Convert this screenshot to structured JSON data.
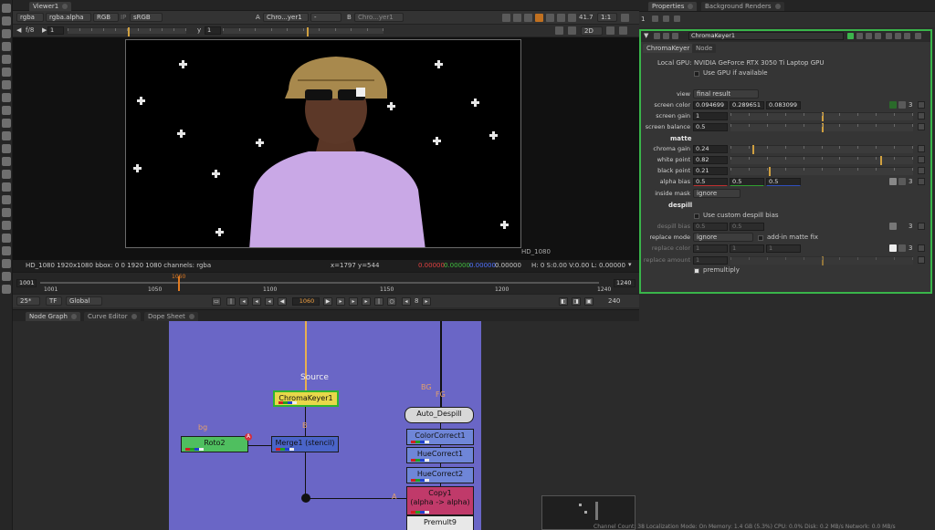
{
  "viewer": {
    "tab": "Viewer1",
    "channels": "rgba",
    "alpha_channel": "rgba.alpha",
    "colorspace_mode": "RGB",
    "ip_label": "IP",
    "display_lut": "sRGB",
    "input_a_label": "A",
    "input_a": "Chro...yer1",
    "input_b_label": "B",
    "input_b": "Chro...yer1",
    "compare_mode": "-",
    "gain": "41.7",
    "zoom": "1:1",
    "fstop": "f/8",
    "frame_val": "1",
    "y_label": "y",
    "y_val": "1",
    "view_mode": "2D",
    "format_label": "HD_1080",
    "info_left": "HD_1080 1920x1080  bbox: 0 0 1920 1080 channels: rgba",
    "info_coords": "x=1797 y=544",
    "info_r": "0.00000",
    "info_g": "0.00000",
    "info_b": "0.00000",
    "info_a": "0.00000",
    "info_hsvl": "H:  0 S:0.00 V:0.00  L: 0.00000"
  },
  "timeline": {
    "start": "1001",
    "end": "1240",
    "current": "1060",
    "ticks": [
      "1001",
      "1050",
      "1100",
      "1150",
      "1200",
      "1240"
    ],
    "playhead_marker": "1060",
    "fps": "25*",
    "tf": "TF",
    "scope": "Global",
    "current_frame_field": "1060",
    "step": "8",
    "end_field": "240"
  },
  "node_graph": {
    "tabs": [
      "Node Graph",
      "Curve Editor",
      "Dope Sheet"
    ],
    "nodes": {
      "source": "Source",
      "chromakeyer": "ChromaKeyer1",
      "roto": "Roto2",
      "merge": "Merge1 (stencil)",
      "despill": "Auto_Despill",
      "colorcorrect": "ColorCorrect1",
      "huecorrect1": "HueCorrect1",
      "huecorrect2": "HueCorrect2",
      "copy": "Copy1",
      "copy_sub": "(alpha -> alpha)",
      "premult": "Premult9"
    },
    "labels": {
      "bg": "bg",
      "b": "B",
      "a": "A",
      "bg2": "BG",
      "fg": "FG",
      "a2": "A",
      "roto_badge": "A"
    }
  },
  "properties": {
    "tabs": [
      "Properties",
      "Background Renders"
    ],
    "max_panels": "1",
    "node_name": "ChromaKeyer1",
    "subtabs": [
      "ChromaKeyer",
      "Node"
    ],
    "local_gpu_label": "Local GPU:",
    "local_gpu_value": "NVIDIA GeForce RTX 3050 Ti Laptop GPU",
    "use_gpu_label": "Use GPU if available",
    "view_label": "view",
    "view_value": "final result",
    "screen_color_label": "screen color",
    "screen_color": [
      "0.094699",
      "0.289651",
      "0.083099"
    ],
    "screen_color_count": "3",
    "screen_gain_label": "screen gain",
    "screen_gain": "1",
    "screen_balance_label": "screen balance",
    "screen_balance": "0.5",
    "matte_title": "matte",
    "chroma_gain_label": "chroma gain",
    "chroma_gain": "0.24",
    "white_point_label": "white point",
    "white_point": "0.82",
    "black_point_label": "black point",
    "black_point": "0.21",
    "alpha_bias_label": "alpha bias",
    "alpha_bias": [
      "0.5",
      "0.5",
      "0.5"
    ],
    "alpha_bias_count": "3",
    "inside_mask_label": "inside mask",
    "inside_mask": "ignore",
    "despill_title": "despill",
    "custom_despill_label": "Use custom despill bias",
    "despill_bias_label": "despill bias",
    "despill_bias": [
      "0.5",
      "0.5"
    ],
    "despill_bias_count": "3",
    "replace_mode_label": "replace mode",
    "replace_mode": "ignore",
    "addin_label": "add-in matte fix",
    "replace_color_label": "replace color",
    "replace_color": [
      "1",
      "1",
      "1"
    ],
    "replace_color_count": "3",
    "replace_amount_label": "replace amount",
    "replace_amount": "1",
    "premultiply_label": "premultiply",
    "slider_ticks_a": [
      "0",
      "0.2",
      "0.4",
      "0.6",
      "0.8",
      "1",
      "1.2",
      "1.4",
      "1.6",
      "1.8"
    ],
    "slider_ticks_b": [
      "0",
      "0.1",
      "0.2",
      "0.3",
      "0.4",
      "0.5",
      "0.6",
      "0.7",
      "0.8",
      "0.9"
    ]
  },
  "status_bar": "Channel Count: 38  Localization Mode: On  Memory: 1.4 GB (5.3%)  CPU: 0.0%  Disk: 0.2 MB/s  Network: 0.0 MB/s"
}
